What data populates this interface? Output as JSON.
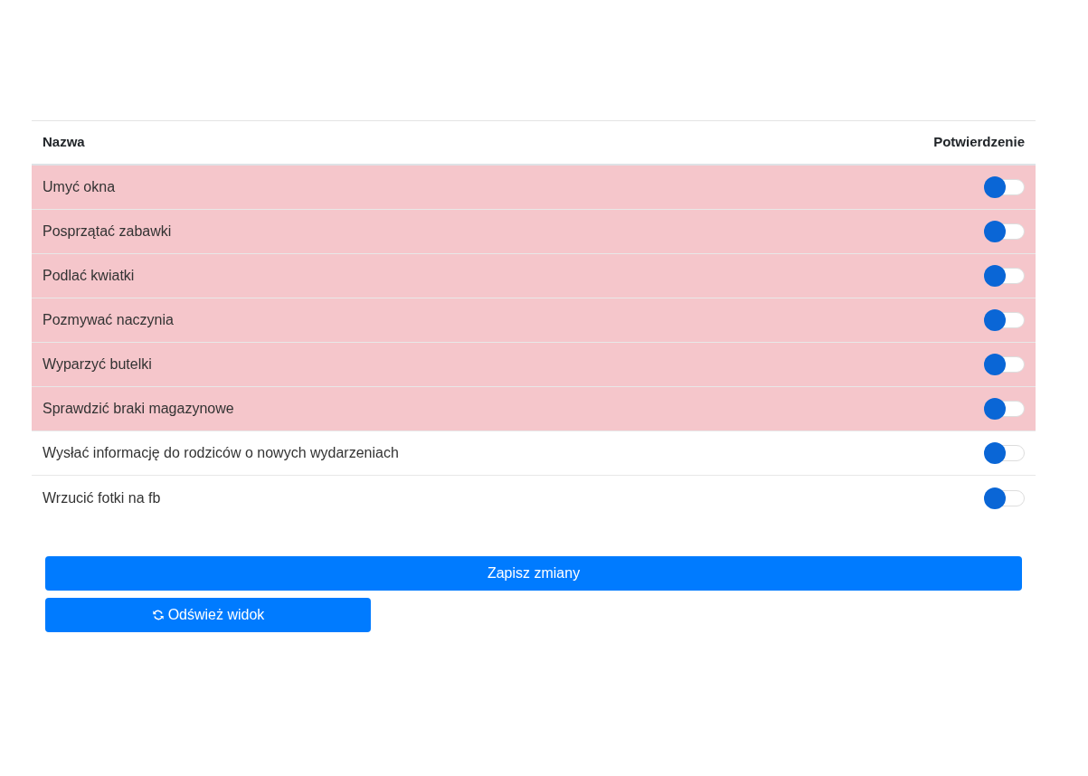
{
  "table": {
    "columns": [
      "Nazwa",
      "Potwierdzenie"
    ],
    "rows": [
      {
        "name": "Umyć okna",
        "highlighted": true,
        "on": false
      },
      {
        "name": "Posprzątać zabawki",
        "highlighted": true,
        "on": false
      },
      {
        "name": "Podlać kwiatki",
        "highlighted": true,
        "on": false
      },
      {
        "name": "Pozmywać naczynia",
        "highlighted": true,
        "on": false
      },
      {
        "name": "Wyparzyć butelki",
        "highlighted": true,
        "on": false
      },
      {
        "name": "Sprawdzić braki magazynowe",
        "highlighted": true,
        "on": false
      },
      {
        "name": "Wysłać informację do rodziców o nowych wydarzeniach",
        "highlighted": false,
        "on": false
      },
      {
        "name": "Wrzucić fotki na fb",
        "highlighted": false,
        "on": false
      }
    ]
  },
  "buttons": {
    "save": "Zapisz zmiany",
    "refresh": "Odśwież widok"
  }
}
